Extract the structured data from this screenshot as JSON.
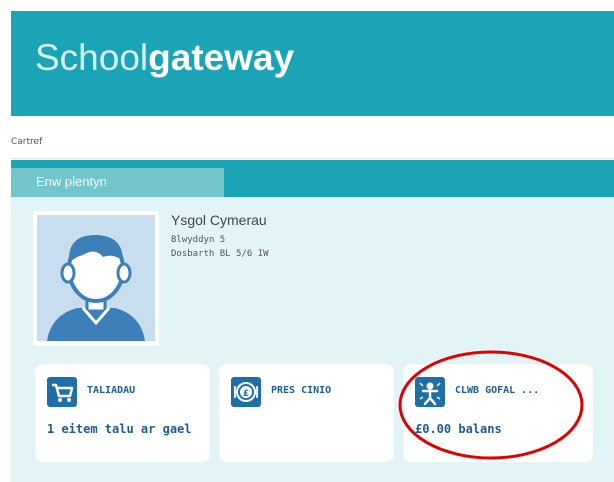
{
  "brand": {
    "logo_part1": "Scho",
    "logo_part2": "ol",
    "logo_part3": "gateway"
  },
  "breadcrumb": {
    "home": "Cartref"
  },
  "tabs": [
    {
      "label": "Enw plentyn"
    }
  ],
  "child": {
    "school": "Ysgol Cymerau",
    "year": "Blwyddyn 5",
    "class": "Dosbarth BL 5/6 IW"
  },
  "cards": [
    {
      "title": "TALIADAU",
      "value": "1 eitem talu ar gael",
      "icon": "shopping-cart-icon"
    },
    {
      "title": "PRES CINIO",
      "value": "",
      "icon": "pound-coin-plate-icon"
    },
    {
      "title": "CLWB GOFAL ...",
      "value": "£0.00 balans",
      "icon": "club-person-icon"
    }
  ],
  "colors": {
    "header": "#1aa4b6",
    "tab_active": "#71c6ce",
    "panel": "#e3f4f7",
    "card_text": "#1f5c8f",
    "icon_bg": "#1e6ea8",
    "annotation": "#e00000"
  }
}
